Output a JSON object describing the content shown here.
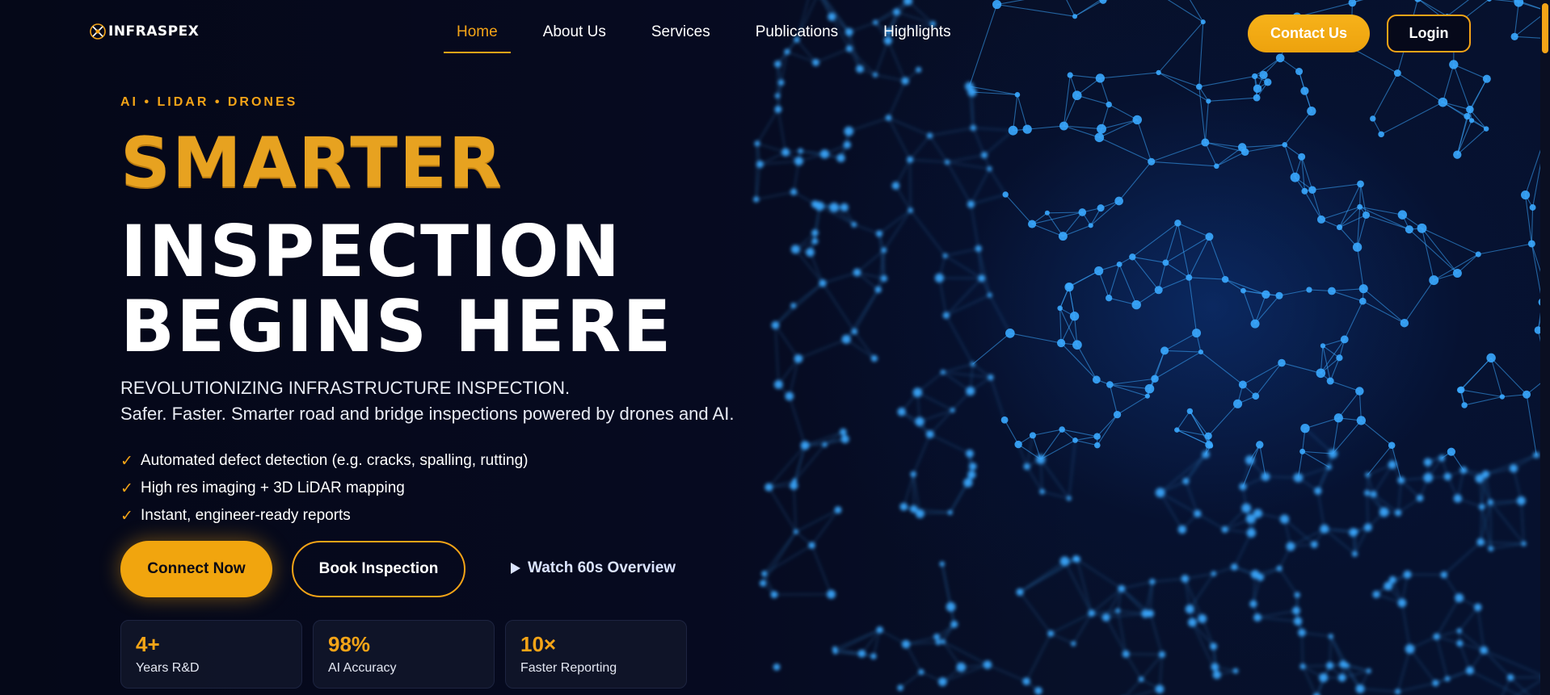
{
  "brand": {
    "logo_text": "INFRASPEX",
    "accent_color": "#f4a417"
  },
  "nav": {
    "items": [
      {
        "label": "Home",
        "active": true
      },
      {
        "label": "About Us"
      },
      {
        "label": "Services"
      },
      {
        "label": "Publications"
      },
      {
        "label": "Highlights"
      }
    ],
    "contact_label": "Contact Us",
    "login_label": "Login"
  },
  "hero": {
    "eyebrow": "AI • LIDAR • DRONES",
    "headline_accent": "SMARTER",
    "headline_line2": "INSPECTION",
    "headline_line3": "BEGINS HERE",
    "subtitle_line1": "REVOLUTIONIZING INFRASTRUCTURE INSPECTION.",
    "subtitle_line2": "Safer. Faster. Smarter road and bridge inspections powered by drones and AI.",
    "features": [
      {
        "check": "✓",
        "text": "Automated defect detection (e.g. cracks, spalling, rutting)"
      },
      {
        "check": "✓",
        "text": "High res imaging + 3D LiDAR mapping"
      },
      {
        "check": "✓",
        "text": "Instant, engineer-ready reports"
      }
    ],
    "buttons": {
      "connect": "Connect Now",
      "book": "Book Inspection",
      "watch": "Watch 60s Overview",
      "watch_icon": "play-icon"
    },
    "stats": [
      {
        "value": "4+",
        "label": "Years R&D"
      },
      {
        "value": "98%",
        "label": "AI Accuracy"
      },
      {
        "value": "10×",
        "label": "Faster Reporting"
      }
    ]
  },
  "background": {
    "visual": "network-mesh",
    "node_color": "#3aa8ff"
  }
}
